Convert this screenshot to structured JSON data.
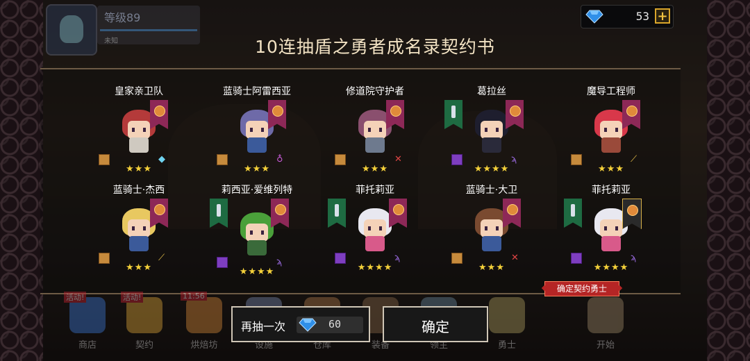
{
  "hud": {
    "level": "等级89",
    "name": "未知",
    "gems": "53",
    "plus": "+"
  },
  "title": "10连抽盾之勇者成名录契约书",
  "heroes": [
    {
      "name": "皇家亲卫队",
      "stars": "★★★",
      "banner": "gold",
      "scroll": "gold",
      "hair": "#b43a3a",
      "body": "#cfc9c0"
    },
    {
      "name": "蓝骑士阿雷西亚",
      "stars": "★★★",
      "banner": "gold",
      "scroll": "gold",
      "hair": "#6e6aa8",
      "body": "#3b5a9a"
    },
    {
      "name": "修道院守护者",
      "stars": "★★★",
      "banner": "gold",
      "scroll": "gold",
      "hair": "#8a4f6e",
      "body": "#6e7a8e"
    },
    {
      "name": "葛拉丝",
      "stars": "★★★★",
      "banner": "green",
      "scroll": "purple",
      "hair": "#1e1e2e",
      "body": "#2a2a3a"
    },
    {
      "name": "魔导工程师",
      "stars": "★★★",
      "banner": "gold",
      "scroll": "gold",
      "hair": "#d8384a",
      "body": "#9a4a3a"
    },
    {
      "name": "蓝骑士·杰西",
      "stars": "★★★",
      "banner": "gold",
      "scroll": "gold",
      "hair": "#e8c860",
      "body": "#3b5a9a"
    },
    {
      "name": "莉西亚·爱维列特",
      "stars": "★★★★",
      "banner": "green",
      "scroll": "purple",
      "hair": "#4aa03a",
      "body": "#3a6a3a"
    },
    {
      "name": "菲托莉亚",
      "stars": "★★★★",
      "banner": "green",
      "scroll": "purple",
      "hair": "#e8e8f0",
      "body": "#d85a8a"
    },
    {
      "name": "蓝骑士·大卫",
      "stars": "★★★",
      "banner": "gold",
      "scroll": "gold",
      "hair": "#7a4a30",
      "body": "#3b5a9a"
    },
    {
      "name": "菲托莉亚",
      "stars": "★★★★",
      "banner": "green",
      "scroll": "purple",
      "hair": "#e8e8f0",
      "body": "#d85a8a"
    }
  ],
  "confirm_tag": "确定契约勇士",
  "nav": [
    {
      "label": "商店",
      "tag": "活动!"
    },
    {
      "label": "契约",
      "tag": "活动!"
    },
    {
      "label": "烘焙坊",
      "tag": "11:56"
    },
    {
      "label": "设施",
      "tag": ""
    },
    {
      "label": "仓库",
      "tag": ""
    },
    {
      "label": "装备",
      "tag": ""
    },
    {
      "label": "领主",
      "tag": ""
    },
    {
      "label": "勇士",
      "tag": ""
    },
    {
      "label": "开始",
      "tag": ""
    }
  ],
  "buttons": {
    "again": "再抽一次",
    "again_cost": "60",
    "confirm": "确定"
  },
  "colors": {
    "gem": "#2f8fe8",
    "star": "#f5d13a",
    "tag_red": "#b52525"
  }
}
